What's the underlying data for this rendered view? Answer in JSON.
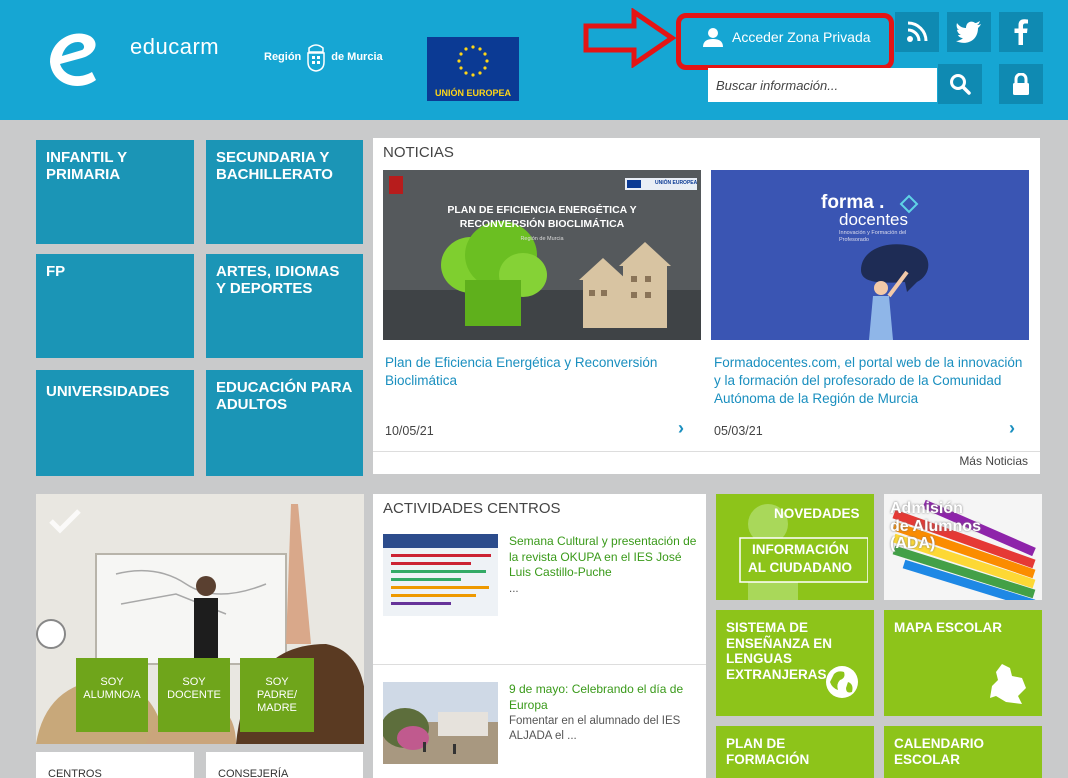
{
  "header": {
    "brand": "educarm",
    "region_left": "Región",
    "region_right": "de Murcia",
    "eu_label": "UNIÓN EUROPEA",
    "private_zone": "Acceder Zona Privada",
    "search_placeholder": "Buscar información..."
  },
  "categories": [
    {
      "label": "INFANTIL Y PRIMARIA"
    },
    {
      "label": "SECUNDARIA Y BACHILLERATO"
    },
    {
      "label": "FP"
    },
    {
      "label": "ARTES, IDIOMAS Y DEPORTES"
    },
    {
      "label": "UNIVERSIDADES"
    },
    {
      "label": "EDUCACIÓN PARA ADULTOS"
    }
  ],
  "news": {
    "title": "NOTICIAS",
    "items": [
      {
        "image_heading": "PLAN DE EFICIENCIA ENERGÉTICA Y RECONVERSIÓN BIOCLIMÁTICA",
        "image_sub": "Región de Murcia",
        "image_badge": "UNIÓN EUROPEA",
        "title": "Plan de Eficiencia Energética y Reconversión Bioclimática",
        "date": "10/05/21"
      },
      {
        "image_brand_top": "forma .",
        "image_brand_bottom": "docentes",
        "image_tagline": "Innovación y Formación del Profesorado",
        "title": "Formadocentes.com, el portal web de la innovación y la formación del profesorado de la Comunidad Autónoma de la Región de Murcia",
        "date": "05/03/21"
      }
    ],
    "more": "Más Noticias"
  },
  "activities": {
    "title": "ACTIVIDADES CENTROS",
    "items": [
      {
        "title": "Semana Cultural y presentación de la revista OKUPA en el IES José Luis Castillo-Puche",
        "desc": "..."
      },
      {
        "title": "9 de mayo: Celebrando el día de Europa",
        "desc": "Fomentar en el alumnado del IES ALJADA el ..."
      }
    ]
  },
  "roles": [
    {
      "line1": "SOY",
      "line2": "ALUMNO/A",
      "line3": ""
    },
    {
      "line1": "SOY",
      "line2": "DOCENTE",
      "line3": ""
    },
    {
      "line1": "SOY",
      "line2": "PADRE/",
      "line3": "MADRE"
    }
  ],
  "green_tiles": {
    "novedades": "NOVEDADES",
    "info_line1": "INFORMACIÓN",
    "info_line2": "AL CIUDADANO",
    "admision_line1": "Admisión",
    "admision_line2": "de Alumnos",
    "admision_line3": "(ADA)",
    "sistema": "SISTEMA DE ENSEÑANZA EN LENGUAS EXTRANJERAS",
    "mapa": "MAPA ESCOLAR",
    "plan": "PLAN DE FORMACIÓN",
    "calendario": "CALENDARIO ESCOLAR"
  },
  "bottom": {
    "centros": "CENTROS",
    "consejeria": "CONSEJERÍA"
  },
  "colors": {
    "header_blue": "#16a6d3",
    "tile_blue": "#1b95b6",
    "green": "#8dc41a",
    "highlight_red": "#e41414"
  }
}
